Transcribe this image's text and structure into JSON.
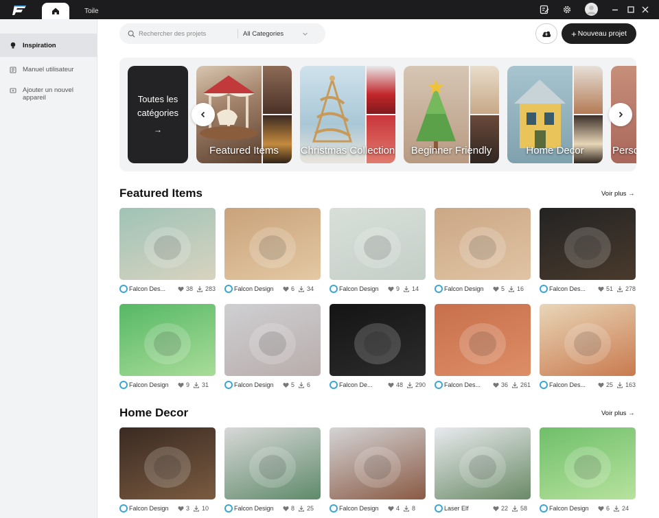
{
  "app": {
    "tabs": [
      {
        "icon": "home-icon"
      },
      {
        "label": "Toile"
      }
    ],
    "window_icons": [
      "edit-icon",
      "gear-icon",
      "avatar",
      "minimize-icon",
      "maximize-icon",
      "close-icon"
    ]
  },
  "sidebar": {
    "items": [
      {
        "label": "Inspiration",
        "icon": "bulb-icon",
        "active": true
      },
      {
        "label": "Manuel utilisateur",
        "icon": "book-icon"
      },
      {
        "label": "Ajouter un nouvel appareil",
        "icon": "device-add-icon"
      }
    ]
  },
  "search": {
    "placeholder": "Rechercher des projets",
    "category": "All Categories"
  },
  "toolbar": {
    "new_project": "Nouveau projet"
  },
  "categories": {
    "all_label": "Toutes les catégories",
    "items": [
      {
        "label": "Featured Items"
      },
      {
        "label": "Christmas Collection"
      },
      {
        "label": "Beginner Friendly"
      },
      {
        "label": "Home Decor"
      },
      {
        "label": "Personalized"
      }
    ]
  },
  "sections": [
    {
      "title": "Featured Items",
      "see_more": "Voir plus",
      "rows": [
        [
          {
            "author": "Falcon Des...",
            "likes": "38",
            "downloads": "283",
            "bg": [
              "#9fc3b6",
              "#d8d3c0"
            ]
          },
          {
            "author": "Falcon Design",
            "likes": "6",
            "downloads": "34",
            "bg": [
              "#c9a27a",
              "#e3c9a4"
            ]
          },
          {
            "author": "Falcon Design",
            "likes": "9",
            "downloads": "14",
            "bg": [
              "#d8dfd9",
              "#c4cfc8"
            ]
          },
          {
            "author": "Falcon Design",
            "likes": "5",
            "downloads": "16",
            "bg": [
              "#cba785",
              "#e0c4a4"
            ]
          },
          {
            "author": "Falcon Des...",
            "likes": "51",
            "downloads": "278",
            "bg": [
              "#232323",
              "#4a3a2c"
            ]
          }
        ],
        [
          {
            "author": "Falcon Design",
            "likes": "9",
            "downloads": "31",
            "bg": [
              "#56b865",
              "#a9dc98"
            ]
          },
          {
            "author": "Falcon Design",
            "likes": "5",
            "downloads": "6",
            "bg": [
              "#cfcfd2",
              "#b8adab"
            ]
          },
          {
            "author": "Falcon De...",
            "likes": "48",
            "downloads": "290",
            "bg": [
              "#141414",
              "#2c2c2c"
            ]
          },
          {
            "author": "Falcon Des...",
            "likes": "36",
            "downloads": "261",
            "bg": [
              "#c86f4c",
              "#dd8e66"
            ]
          },
          {
            "author": "Falcon Des...",
            "likes": "25",
            "downloads": "163",
            "bg": [
              "#e8d6b8",
              "#c97a4e"
            ]
          }
        ]
      ]
    },
    {
      "title": "Home Decor",
      "see_more": "Voir plus",
      "rows": [
        [
          {
            "author": "Falcon Design",
            "likes": "3",
            "downloads": "10",
            "bg": [
              "#3a2a22",
              "#7a5b40"
            ]
          },
          {
            "author": "Falcon Design",
            "likes": "8",
            "downloads": "25",
            "bg": [
              "#d8d8d8",
              "#5f8a6a"
            ]
          },
          {
            "author": "Falcon Design",
            "likes": "4",
            "downloads": "8",
            "bg": [
              "#d4d4d6",
              "#8a5a44"
            ]
          },
          {
            "author": "Laser Elf",
            "likes": "22",
            "downloads": "58",
            "bg": [
              "#e8eaee",
              "#6a8a66"
            ]
          },
          {
            "author": "Falcon Design",
            "likes": "6",
            "downloads": "24",
            "bg": [
              "#6fbf6a",
              "#b7e29e"
            ]
          }
        ]
      ]
    }
  ],
  "colors": {
    "titlebar": "#1c1c1e",
    "sidebar_bg": "#f2f3f5",
    "primary_button": "#1f1f1f",
    "avatar_ring": "#3aa6d6"
  }
}
